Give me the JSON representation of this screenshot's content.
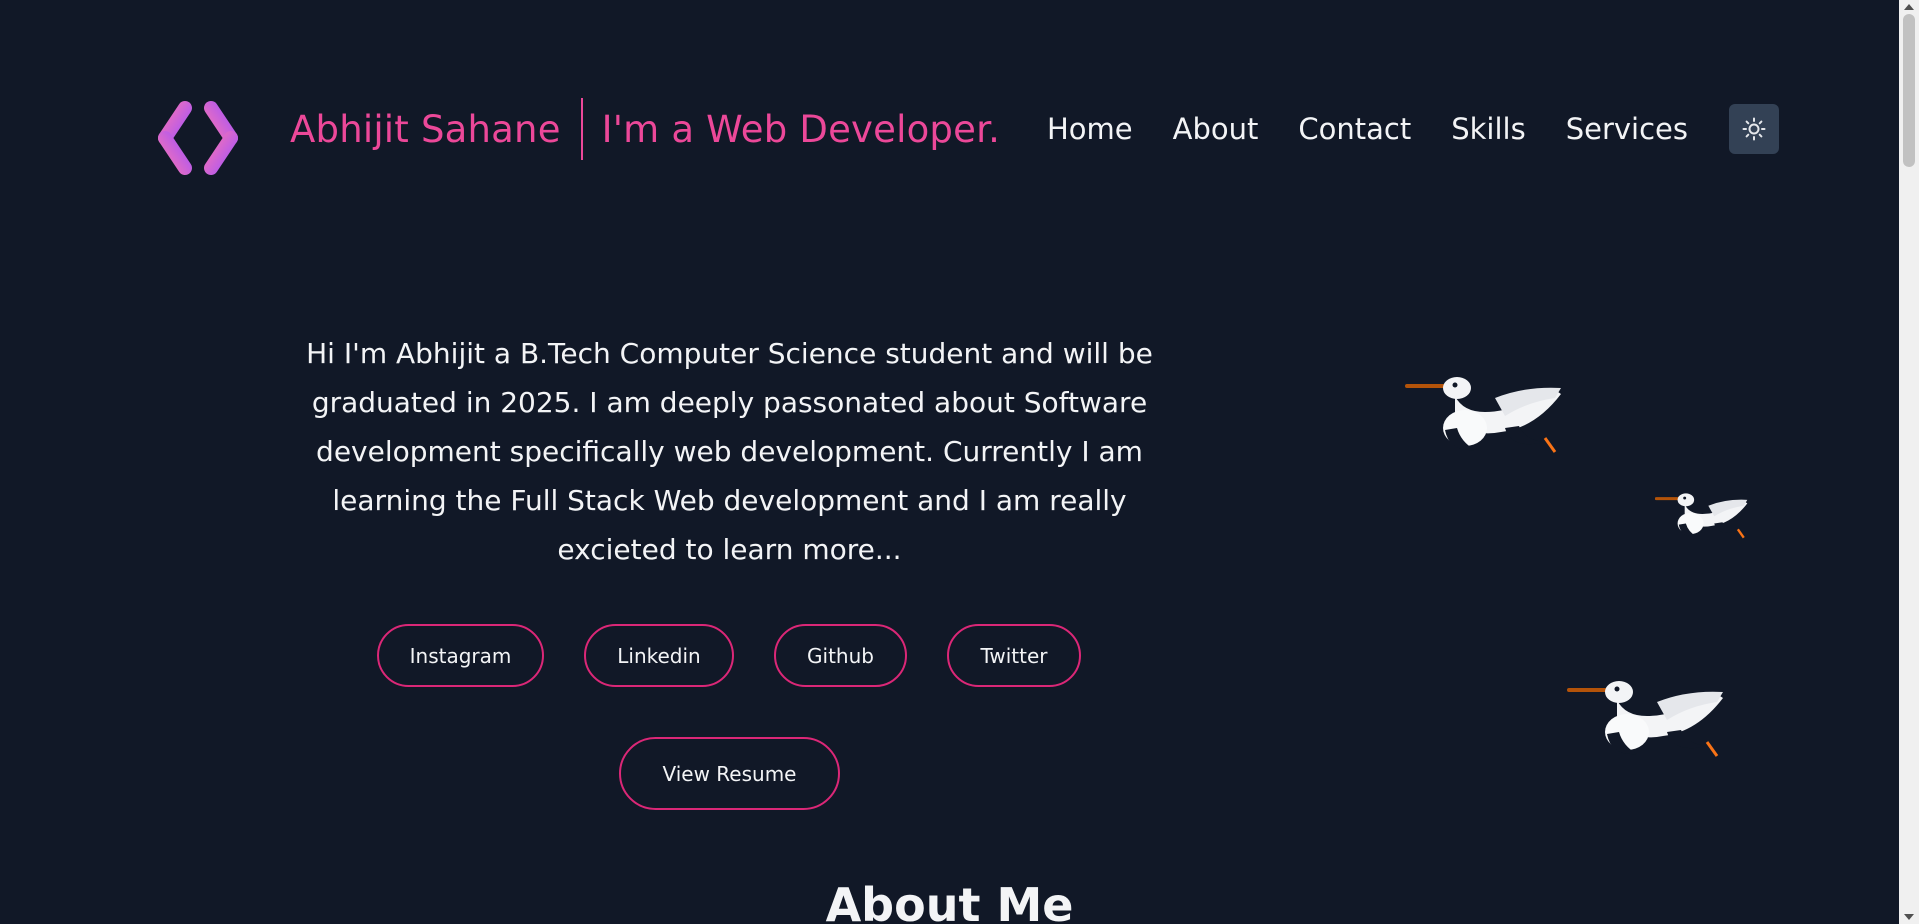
{
  "header": {
    "name": "Abhijit Sahane",
    "tagline": "I'm a Web Developer.",
    "nav": [
      {
        "label": "Home"
      },
      {
        "label": "About"
      },
      {
        "label": "Contact"
      },
      {
        "label": "Skills"
      },
      {
        "label": "Services"
      }
    ],
    "theme_icon": "sun-icon"
  },
  "hero": {
    "bio_lines": [
      "Hi I'm Abhijit a B.Tech Computer Science student and will be",
      "graduated in 2025. I am deeply passonated about Software",
      "development specifically web development. Currently I am",
      "learning the Full Stack Web development and I am really",
      "excieted to learn more..."
    ],
    "socials": [
      {
        "label": "Instagram"
      },
      {
        "label": "Linkedin"
      },
      {
        "label": "Github"
      },
      {
        "label": "Twitter"
      }
    ],
    "resume_label": "View Resume"
  },
  "about": {
    "heading": "About Me"
  },
  "colors": {
    "background": "#111827",
    "accent": "#ec4899",
    "border_accent": "#db2777",
    "text": "#f3f4f6"
  }
}
